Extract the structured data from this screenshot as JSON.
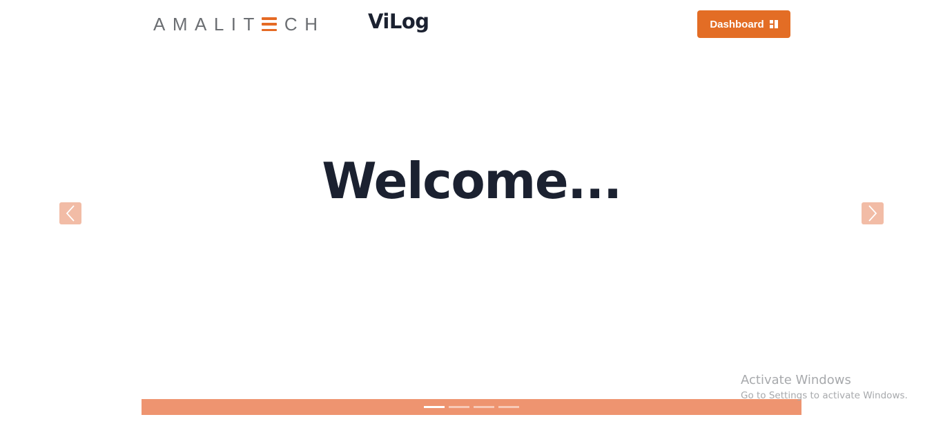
{
  "header": {
    "logo_text_left": "AMALIT",
    "logo_text_right": "CH",
    "logo_full": "AMALITECH",
    "app_title": "ViLog",
    "dashboard_label": "Dashboard",
    "dashboard_icon": "dashboard-grid-icon"
  },
  "carousel": {
    "slide_heading": "Welcome...",
    "prev_icon": "chevron-left-icon",
    "next_icon": "chevron-right-icon",
    "indicator_count": 4,
    "active_index": 0
  },
  "watermark": {
    "title": "Activate Windows",
    "subtitle": "Go to Settings to activate Windows."
  },
  "colors": {
    "brand_orange": "#e36d25",
    "indicator_bar": "#ee9470",
    "arrow_bg": "#f2bca6",
    "heading": "#1b2130"
  }
}
